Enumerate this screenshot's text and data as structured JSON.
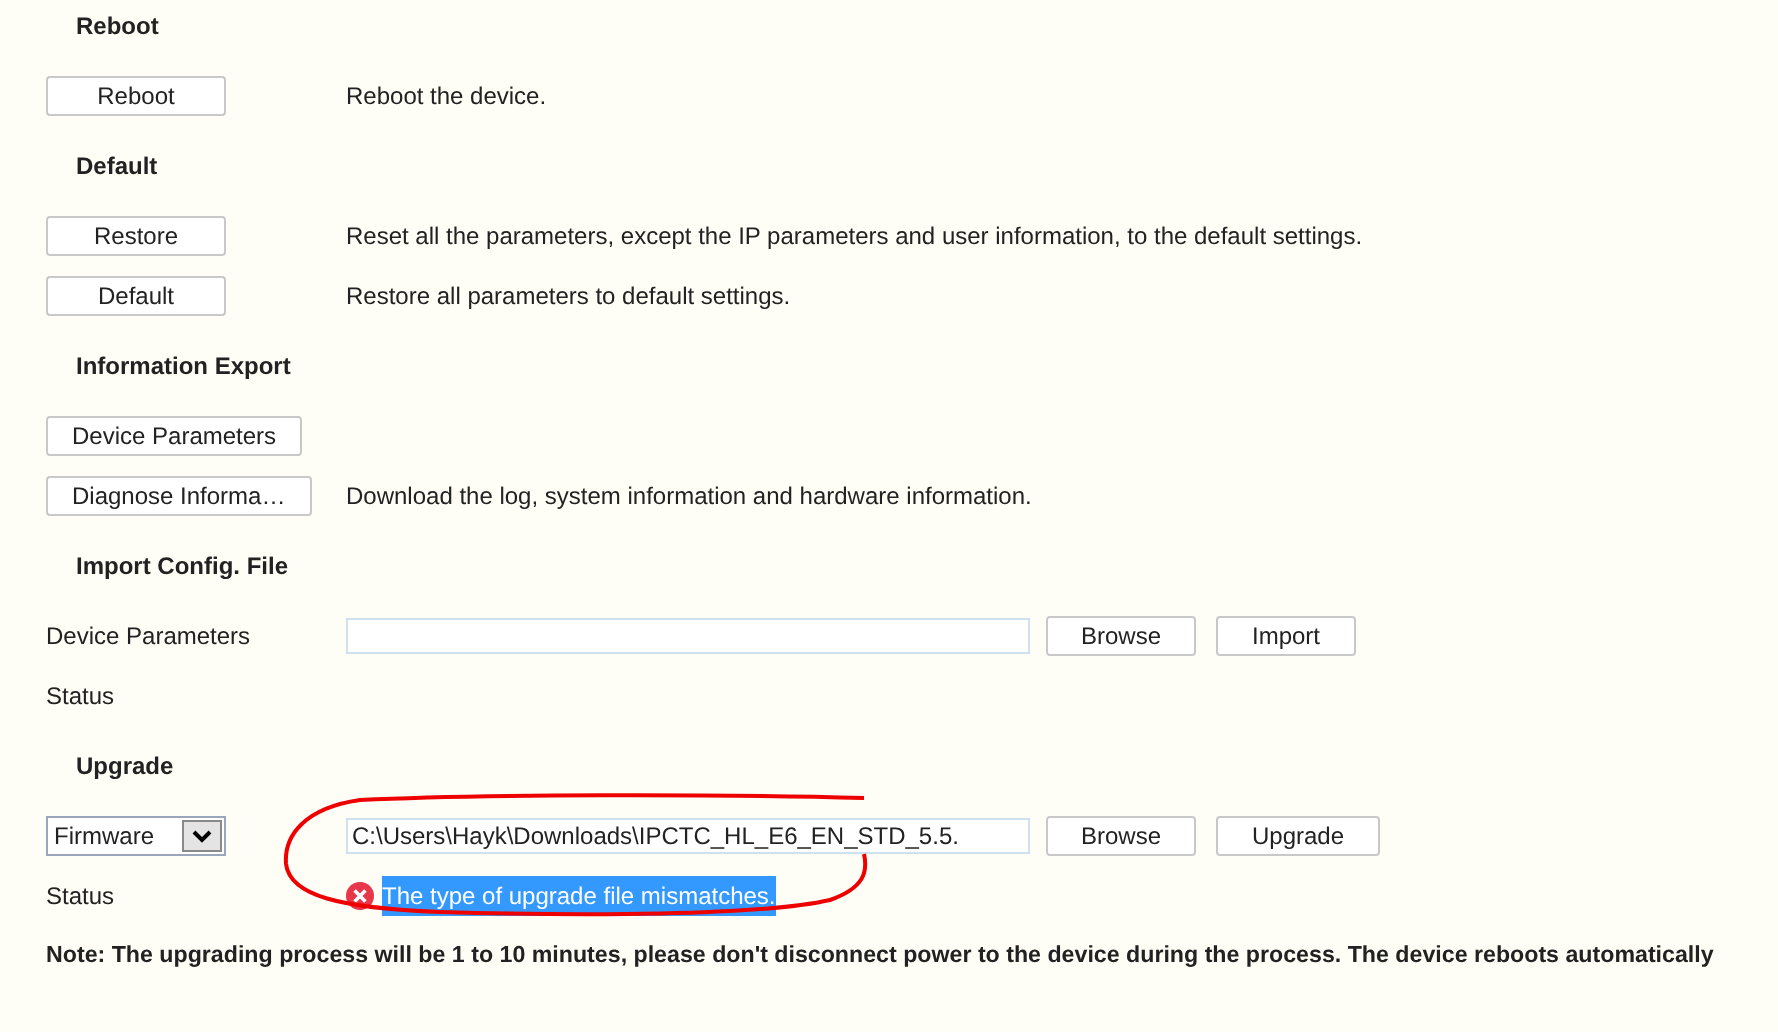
{
  "sections": [
    {
      "title": "Reboot",
      "rows": [
        {
          "kind": "action",
          "button": "Reboot",
          "description": "Reboot the device."
        }
      ]
    },
    {
      "title": "Default",
      "rows": [
        {
          "kind": "action",
          "button": "Restore",
          "description": "Reset all the parameters, except the IP parameters and user information, to the default settings."
        },
        {
          "kind": "action",
          "button": "Default",
          "description": "Restore all parameters to default settings."
        }
      ]
    },
    {
      "title": "Information Export",
      "rows": [
        {
          "kind": "action",
          "button": "Device Parameters"
        },
        {
          "kind": "action",
          "button": "Diagnose Informa…",
          "description": "Download the log, system information and hardware information."
        }
      ]
    },
    {
      "title": "Import Config. File",
      "rows": [
        {
          "kind": "file",
          "label": "Device Parameters",
          "buttons": [
            "Browse",
            "Import"
          ]
        },
        {
          "kind": "status",
          "label": "Status"
        }
      ]
    },
    {
      "title": "Upgrade",
      "rows": [
        {
          "kind": "select-file",
          "select": "Firmware",
          "value": "C:\\Users\\Hayk\\Downloads\\IPCTC_HL_E6_EN_STD_5.5.",
          "buttons": [
            "Browse",
            "Upgrade"
          ]
        },
        {
          "kind": "status",
          "label": "Status",
          "message": "The type of upgrade file mismatches.",
          "error": true,
          "selected": true
        }
      ]
    }
  ],
  "note": "Note: The upgrading process will be 1 to 10 minutes, please don't disconnect power to the device during the process. The device reboots automatically",
  "annotation": {
    "kind": "circle"
  }
}
